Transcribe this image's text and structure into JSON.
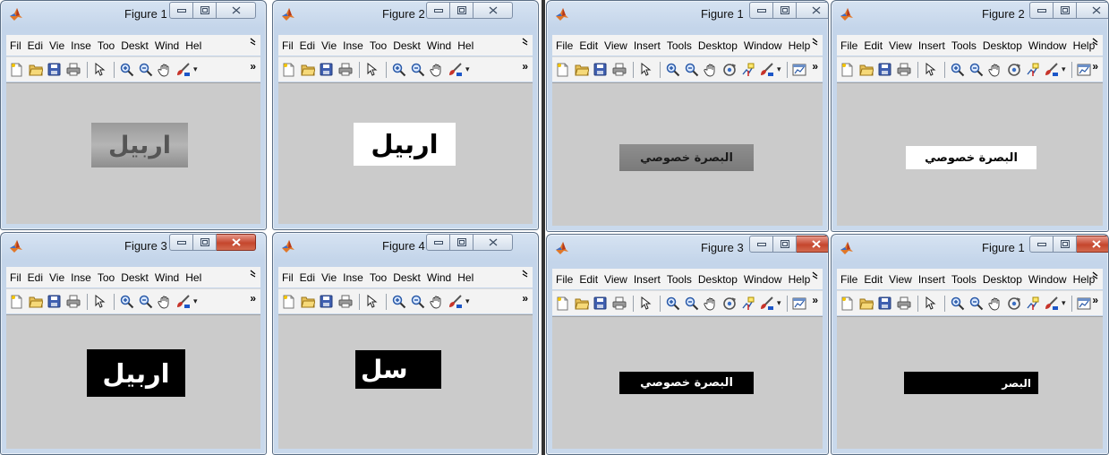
{
  "left": {
    "menu_labels": [
      "Fil",
      "Edi",
      "Vie",
      "Inse",
      "Too",
      "Deskt",
      "Wind",
      "Hel"
    ],
    "windows": [
      {
        "title": "Figure 1",
        "plate_text": "اربيل"
      },
      {
        "title": "Figure 2",
        "plate_text": "اربيل"
      },
      {
        "title": "Figure 3",
        "plate_text": "اربيل"
      },
      {
        "title": "Figure 4",
        "plate_text": "سل"
      }
    ]
  },
  "right": {
    "menu_labels": [
      "File",
      "Edit",
      "View",
      "Insert",
      "Tools",
      "Desktop",
      "Window",
      "Help"
    ],
    "windows": [
      {
        "title": "Figure 1",
        "plate_text": "البصرة  خصوصي"
      },
      {
        "title": "Figure 2",
        "plate_text": "البصرة  خصوصي"
      },
      {
        "title": "Figure 3",
        "plate_text": "البصرة  خصوصي"
      },
      {
        "title": "Figure 1",
        "plate_text": "البصر"
      }
    ]
  },
  "icons": {
    "window_buttons": [
      "minimize-icon",
      "maximize-icon",
      "close-icon"
    ],
    "toolbar_left": [
      "new-figure-icon",
      "open-file-icon",
      "save-icon",
      "print-icon",
      "pointer-icon",
      "zoom-in-icon",
      "zoom-out-icon",
      "pan-hand-icon",
      "brush-icon"
    ],
    "toolbar_right": [
      "new-figure-icon",
      "open-file-icon",
      "save-icon",
      "print-icon",
      "pointer-icon",
      "zoom-in-icon",
      "zoom-out-icon",
      "pan-hand-icon",
      "rotate-3d-icon",
      "data-cursor-icon",
      "brush-icon",
      "plot-tools-icon"
    ]
  },
  "colors": {
    "title_bar": "#c9d9ec",
    "canvas": "#cbcbcb",
    "close_active": "#c5462d"
  }
}
